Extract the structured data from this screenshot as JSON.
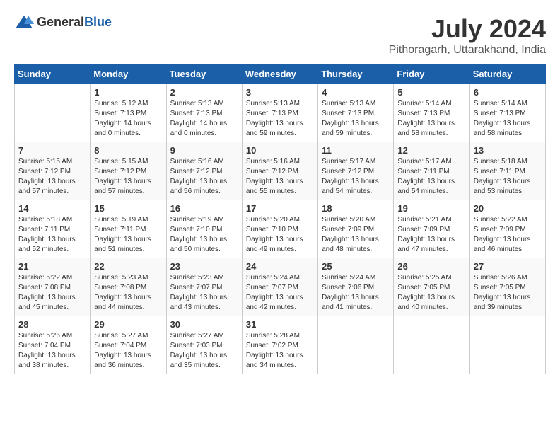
{
  "header": {
    "logo_general": "General",
    "logo_blue": "Blue",
    "title": "July 2024",
    "subtitle": "Pithoragarh, Uttarakhand, India"
  },
  "days_of_week": [
    "Sunday",
    "Monday",
    "Tuesday",
    "Wednesday",
    "Thursday",
    "Friday",
    "Saturday"
  ],
  "weeks": [
    [
      {
        "day": "",
        "info": ""
      },
      {
        "day": "1",
        "info": "Sunrise: 5:12 AM\nSunset: 7:13 PM\nDaylight: 14 hours\nand 0 minutes."
      },
      {
        "day": "2",
        "info": "Sunrise: 5:13 AM\nSunset: 7:13 PM\nDaylight: 14 hours\nand 0 minutes."
      },
      {
        "day": "3",
        "info": "Sunrise: 5:13 AM\nSunset: 7:13 PM\nDaylight: 13 hours\nand 59 minutes."
      },
      {
        "day": "4",
        "info": "Sunrise: 5:13 AM\nSunset: 7:13 PM\nDaylight: 13 hours\nand 59 minutes."
      },
      {
        "day": "5",
        "info": "Sunrise: 5:14 AM\nSunset: 7:13 PM\nDaylight: 13 hours\nand 58 minutes."
      },
      {
        "day": "6",
        "info": "Sunrise: 5:14 AM\nSunset: 7:13 PM\nDaylight: 13 hours\nand 58 minutes."
      }
    ],
    [
      {
        "day": "7",
        "info": "Sunrise: 5:15 AM\nSunset: 7:12 PM\nDaylight: 13 hours\nand 57 minutes."
      },
      {
        "day": "8",
        "info": "Sunrise: 5:15 AM\nSunset: 7:12 PM\nDaylight: 13 hours\nand 57 minutes."
      },
      {
        "day": "9",
        "info": "Sunrise: 5:16 AM\nSunset: 7:12 PM\nDaylight: 13 hours\nand 56 minutes."
      },
      {
        "day": "10",
        "info": "Sunrise: 5:16 AM\nSunset: 7:12 PM\nDaylight: 13 hours\nand 55 minutes."
      },
      {
        "day": "11",
        "info": "Sunrise: 5:17 AM\nSunset: 7:12 PM\nDaylight: 13 hours\nand 54 minutes."
      },
      {
        "day": "12",
        "info": "Sunrise: 5:17 AM\nSunset: 7:11 PM\nDaylight: 13 hours\nand 54 minutes."
      },
      {
        "day": "13",
        "info": "Sunrise: 5:18 AM\nSunset: 7:11 PM\nDaylight: 13 hours\nand 53 minutes."
      }
    ],
    [
      {
        "day": "14",
        "info": "Sunrise: 5:18 AM\nSunset: 7:11 PM\nDaylight: 13 hours\nand 52 minutes."
      },
      {
        "day": "15",
        "info": "Sunrise: 5:19 AM\nSunset: 7:11 PM\nDaylight: 13 hours\nand 51 minutes."
      },
      {
        "day": "16",
        "info": "Sunrise: 5:19 AM\nSunset: 7:10 PM\nDaylight: 13 hours\nand 50 minutes."
      },
      {
        "day": "17",
        "info": "Sunrise: 5:20 AM\nSunset: 7:10 PM\nDaylight: 13 hours\nand 49 minutes."
      },
      {
        "day": "18",
        "info": "Sunrise: 5:20 AM\nSunset: 7:09 PM\nDaylight: 13 hours\nand 48 minutes."
      },
      {
        "day": "19",
        "info": "Sunrise: 5:21 AM\nSunset: 7:09 PM\nDaylight: 13 hours\nand 47 minutes."
      },
      {
        "day": "20",
        "info": "Sunrise: 5:22 AM\nSunset: 7:09 PM\nDaylight: 13 hours\nand 46 minutes."
      }
    ],
    [
      {
        "day": "21",
        "info": "Sunrise: 5:22 AM\nSunset: 7:08 PM\nDaylight: 13 hours\nand 45 minutes."
      },
      {
        "day": "22",
        "info": "Sunrise: 5:23 AM\nSunset: 7:08 PM\nDaylight: 13 hours\nand 44 minutes."
      },
      {
        "day": "23",
        "info": "Sunrise: 5:23 AM\nSunset: 7:07 PM\nDaylight: 13 hours\nand 43 minutes."
      },
      {
        "day": "24",
        "info": "Sunrise: 5:24 AM\nSunset: 7:07 PM\nDaylight: 13 hours\nand 42 minutes."
      },
      {
        "day": "25",
        "info": "Sunrise: 5:24 AM\nSunset: 7:06 PM\nDaylight: 13 hours\nand 41 minutes."
      },
      {
        "day": "26",
        "info": "Sunrise: 5:25 AM\nSunset: 7:05 PM\nDaylight: 13 hours\nand 40 minutes."
      },
      {
        "day": "27",
        "info": "Sunrise: 5:26 AM\nSunset: 7:05 PM\nDaylight: 13 hours\nand 39 minutes."
      }
    ],
    [
      {
        "day": "28",
        "info": "Sunrise: 5:26 AM\nSunset: 7:04 PM\nDaylight: 13 hours\nand 38 minutes."
      },
      {
        "day": "29",
        "info": "Sunrise: 5:27 AM\nSunset: 7:04 PM\nDaylight: 13 hours\nand 36 minutes."
      },
      {
        "day": "30",
        "info": "Sunrise: 5:27 AM\nSunset: 7:03 PM\nDaylight: 13 hours\nand 35 minutes."
      },
      {
        "day": "31",
        "info": "Sunrise: 5:28 AM\nSunset: 7:02 PM\nDaylight: 13 hours\nand 34 minutes."
      },
      {
        "day": "",
        "info": ""
      },
      {
        "day": "",
        "info": ""
      },
      {
        "day": "",
        "info": ""
      }
    ]
  ]
}
